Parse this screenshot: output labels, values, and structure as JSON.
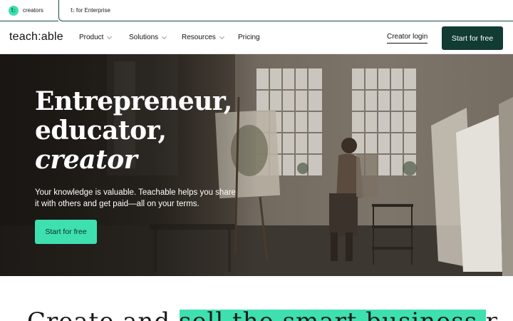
{
  "switcher": {
    "creators_label": "creators",
    "creators_logo": "t:",
    "enterprise_logo": "t:",
    "enterprise_label": "for Enterprise"
  },
  "nav": {
    "brand": "teach:able",
    "items": [
      {
        "label": "Product",
        "has_dropdown": true
      },
      {
        "label": "Solutions",
        "has_dropdown": true
      },
      {
        "label": "Resources",
        "has_dropdown": true
      },
      {
        "label": "Pricing",
        "has_dropdown": false
      }
    ],
    "login_label": "Creator login",
    "cta_label": "Start for free"
  },
  "hero": {
    "headline_line1": "Entrepreneur,",
    "headline_line2": "educator,",
    "headline_line3": "creator",
    "subtext": "Your knowledge is valuable. Teachable helps you share it with others and get paid—all on your terms.",
    "cta_label": "Start for free",
    "image_subject": "artist-painting-in-studio"
  },
  "teaser": {
    "text": "Create and sell the smart business product"
  },
  "colors": {
    "brand_dark": "#113b33",
    "accent_mint": "#3ee0b0",
    "text": "#1a1a1a"
  }
}
